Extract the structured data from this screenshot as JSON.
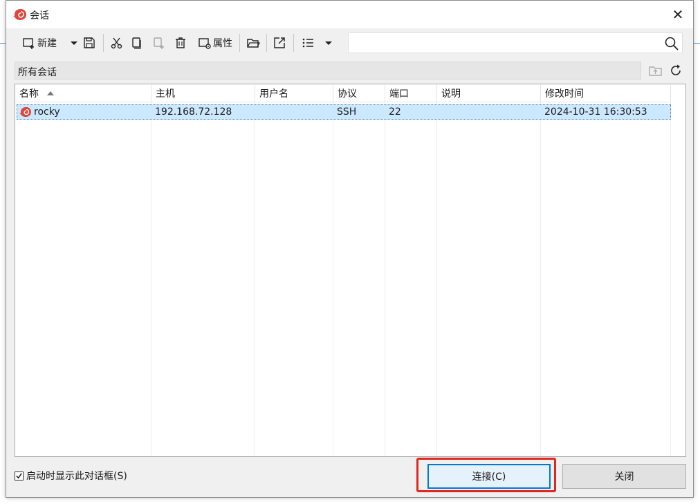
{
  "window": {
    "title": "会话",
    "close_symbol": "✕"
  },
  "toolbar": {
    "new_label": "新建",
    "properties_label": "属性",
    "search_value": "",
    "search_placeholder": ""
  },
  "path": {
    "label": "所有会话"
  },
  "table": {
    "columns": [
      "名称",
      "主机",
      "用户名",
      "协议",
      "端口",
      "说明",
      "修改时间"
    ],
    "sort_column": "名称",
    "rows": [
      {
        "name": "rocky",
        "host": "192.168.72.128",
        "user": "",
        "protocol": "SSH",
        "port": "22",
        "description": "",
        "modified": "2024-10-31 16:30:53",
        "selected": true
      }
    ]
  },
  "footer": {
    "show_on_startup_label": "启动时显示此对话框(S)",
    "show_on_startup_checked": true,
    "connect_label": "连接(C)",
    "close_label": "关闭"
  },
  "colors": {
    "accent": "#0078d7",
    "selection": "#cce8ff",
    "highlight": "#e0261d",
    "logo": "#e0463a"
  },
  "icons": [
    "session-logo-icon",
    "new-session-icon",
    "dropdown-arrow-icon",
    "save-icon",
    "cut-icon",
    "copy-icon",
    "paste-icon",
    "delete-icon",
    "properties-icon",
    "open-folder-icon",
    "export-icon",
    "list-view-icon",
    "search-icon",
    "folder-up-icon",
    "refresh-icon"
  ]
}
